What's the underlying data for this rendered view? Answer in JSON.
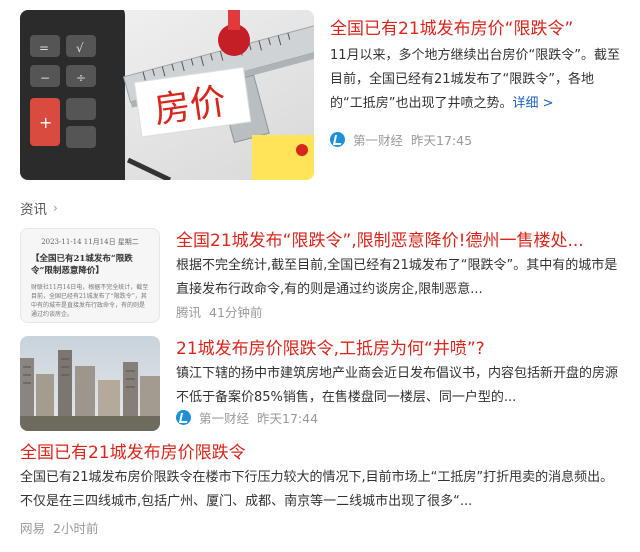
{
  "items": [
    {
      "title": "全国已有21城发布房价“限跌令”",
      "abstract": "11月以来，多个地方继续出台房价“限跌令”。截至目前，全国已经有21城发布了“限跌令”，各地的“工抵房”也出现了井喷之势。",
      "more_label": "详细 >",
      "source": "第一财经",
      "time": "昨天17:45",
      "image_text": "房价"
    },
    {
      "title": "全国21城发布“限跌令”,限制恶意降价!德州一售楼处...",
      "abstract": "根据不完全统计,截至目前,全国已经有21城发布了“限跌令”。其中有的城市是直接发布行政命令,有的则是通过约谈房企,限制恶意...",
      "source": "腾讯",
      "time": "41分钟前",
      "thumb_date": "2023-11-14  11月14日  星期二",
      "thumb_headline": "【全国已有21城发布“限跌令”限制恶意降价】",
      "thumb_body": "财联社11月14日电，根据不完全统计，截至目前，全国已经有21城发布了“限跌令”，其中有的城市是直接发布行政命令，有的则是通过约谈房企。"
    },
    {
      "title": "21城发布房价限跌令,工抵房为何“井喷”?",
      "abstract": "镇江下辖的扬中市建筑房地产业商会近日发布倡议书，内容包括新开盘的房源不低于备案价85%销售，在售楼盘同一楼层、同一户型的...",
      "source": "第一财经",
      "time": "昨天17:44"
    },
    {
      "title": "全国已有21城发布房价限跌令",
      "abstract": "全国已有21城发布房价限跌令在楼市下行压力较大的情况下,目前市场上“工抵房”打折甩卖的消息频出。不仅是在三四线城市,包括广州、厦门、成都、南京等一二线城市出现了很多“...",
      "source": "网易",
      "time": "2小时前"
    }
  ],
  "section": {
    "label": "资讯",
    "chevron": "›"
  },
  "icons": {
    "source_icon": "yicai-logo-icon",
    "section_chevron": "chevron-right-icon"
  },
  "colors": {
    "title": "#d9261c",
    "link": "#1f62c4",
    "meta": "#9a9a9a",
    "source_icon": "#1f8fd6"
  }
}
